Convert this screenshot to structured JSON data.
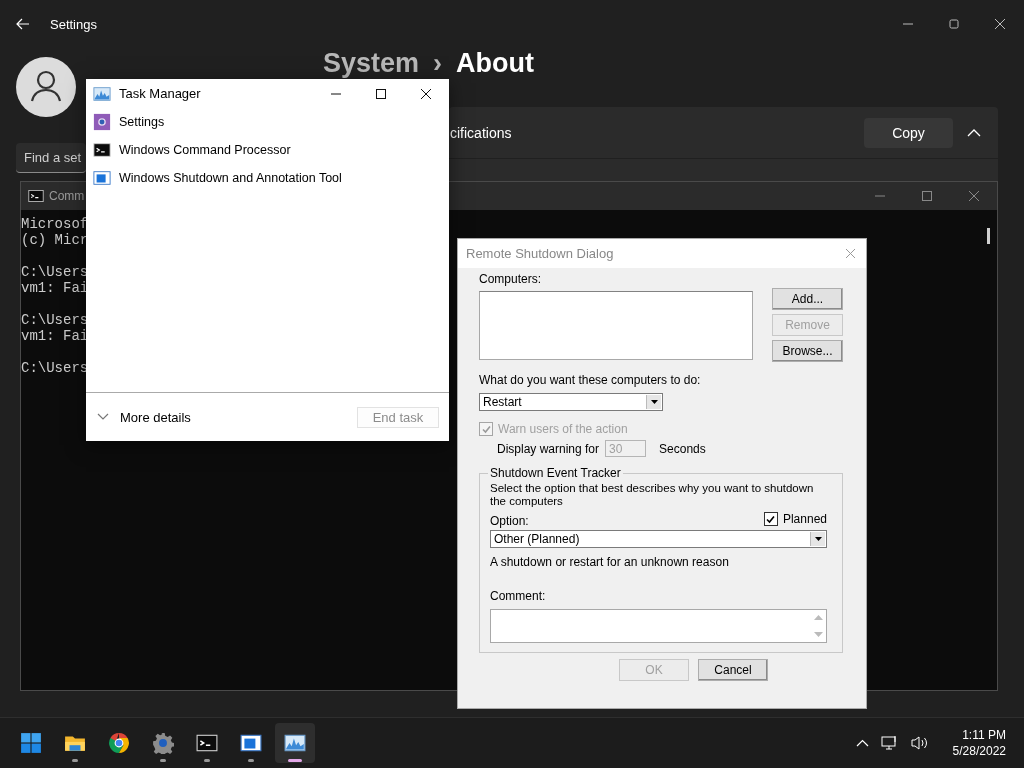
{
  "settings": {
    "title": "Settings",
    "breadcrumb": {
      "parent": "System",
      "separator": "›",
      "current": "About"
    },
    "search": {
      "placeholder": "Find a set"
    },
    "specs": {
      "label": "cifications",
      "copy": "Copy",
      "expanded": true
    }
  },
  "command_prompt": {
    "title": "Comm",
    "blocks": [
      [
        "Microsof",
        "(c) Micr"
      ],
      [
        "C:\\Users",
        "vm1: Fai"
      ],
      [
        "C:\\Users",
        "vm1: Fai"
      ],
      [
        "C:\\Users"
      ]
    ]
  },
  "task_manager": {
    "title": "Task Manager",
    "apps": [
      {
        "name": "Settings",
        "kind": "settings"
      },
      {
        "name": "Windows Command Processor",
        "kind": "terminal"
      },
      {
        "name": "Windows Shutdown and Annotation Tool",
        "kind": "window"
      }
    ],
    "more_details": "More details",
    "end_task": {
      "label": "End task",
      "disabled": true
    }
  },
  "dialog": {
    "title": "Remote Shutdown Dialog",
    "computers_label": "Computers:",
    "buttons": [
      {
        "label": "Add...",
        "disabled": false
      },
      {
        "label": "Remove",
        "disabled": true
      },
      {
        "label": "Browse...",
        "disabled": false
      }
    ],
    "action_label": "What do you want these computers to do:",
    "action": "Restart",
    "warn": {
      "label": "Warn users of the action",
      "checked": true,
      "disabled": true
    },
    "warning_label": "Display warning for",
    "warning_value": "30",
    "warning_disabled": true,
    "warning_unit": "Seconds",
    "tracker": {
      "title": "Shutdown Event Tracker",
      "description": "Select the option that best describes why you want to shutdown the computers",
      "option_label": "Option:",
      "planned": {
        "label": "Planned",
        "checked": true
      },
      "option": "Other (Planned)",
      "reason": "A shutdown or restart for an unknown reason",
      "comment_label": "Comment:"
    },
    "ok": {
      "label": "OK",
      "disabled": true
    },
    "cancel": {
      "label": "Cancel",
      "disabled": false
    }
  },
  "taskbar": {
    "apps": [
      {
        "kind": "start",
        "running": false,
        "selected": false
      },
      {
        "kind": "folder",
        "running": true,
        "selected": false
      },
      {
        "kind": "browser",
        "running": false,
        "selected": false
      },
      {
        "kind": "gear",
        "running": true,
        "selected": false
      },
      {
        "kind": "terminal",
        "running": true,
        "selected": false
      },
      {
        "kind": "window",
        "running": true,
        "selected": false
      },
      {
        "kind": "chart",
        "running": true,
        "selected": true
      }
    ],
    "time": "1:11 PM",
    "date": "5/28/2022"
  }
}
